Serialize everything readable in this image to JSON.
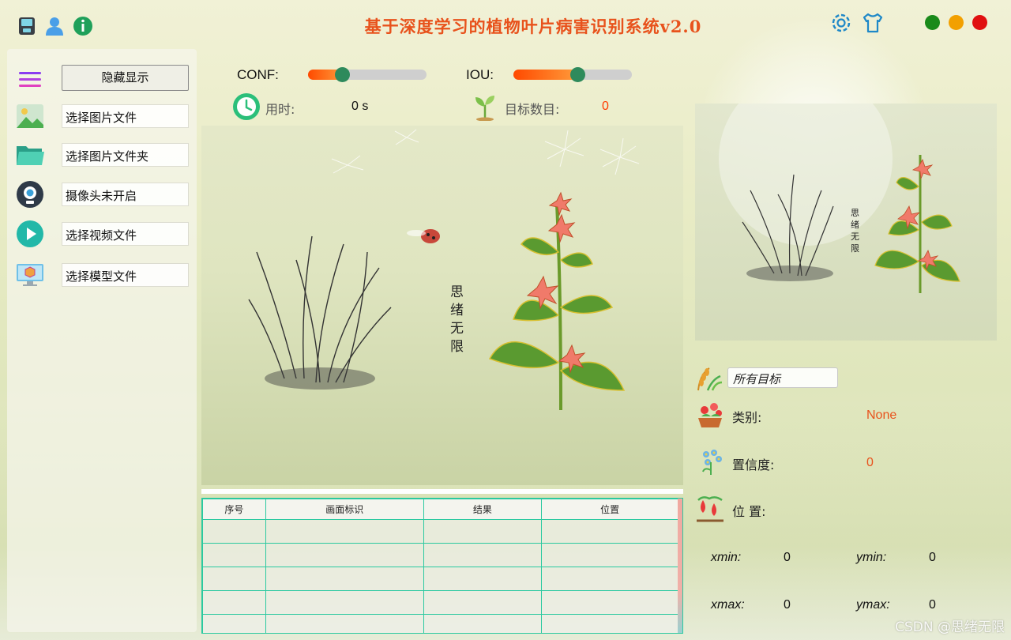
{
  "app": {
    "title": "基于深度学习的植物叶片病害识别系统v2.0"
  },
  "colors": {
    "title": "#e8521c",
    "accent_teal": "#2bc9a0",
    "window_close": "#e01010",
    "window_min": "#f2a000",
    "window_max": "#1a8a1a",
    "value_orange": "#e8521c"
  },
  "topbar": {
    "left_icons": [
      "save-icon",
      "user-icon",
      "info-icon"
    ],
    "right_icons": [
      "settings-gear-icon",
      "skin-shirt-icon"
    ]
  },
  "sidebar": {
    "toggle_label": "隐藏显示",
    "items": [
      {
        "label": "选择图片文件",
        "icon": "image-file-icon"
      },
      {
        "label": "选择图片文件夹",
        "icon": "folder-icon"
      },
      {
        "label": "摄像头未开启",
        "icon": "camera-icon"
      },
      {
        "label": "选择视频文件",
        "icon": "play-video-icon"
      },
      {
        "label": "选择模型文件",
        "icon": "model-monitor-icon"
      }
    ]
  },
  "controls": {
    "conf_label": "CONF:",
    "conf_value": 0.29,
    "iou_label": "IOU:",
    "iou_value": 0.54
  },
  "stats": {
    "time_label": "用时:",
    "time_value": "0 s",
    "count_label": "目标数目:",
    "count_value": "0"
  },
  "image": {
    "calligraphy": "思绪无限"
  },
  "table": {
    "headers": [
      "序号",
      "画面标识",
      "结果",
      "位置"
    ],
    "rows": [
      [
        "",
        "",
        "",
        ""
      ],
      [
        "",
        "",
        "",
        ""
      ],
      [
        "",
        "",
        "",
        ""
      ],
      [
        "",
        "",
        "",
        ""
      ],
      [
        "",
        "",
        "",
        ""
      ]
    ]
  },
  "details": {
    "filter_value": "所有目标",
    "class_label": "类别:",
    "class_value": "None",
    "confidence_label": "置信度:",
    "confidence_value": "0",
    "position_label": "位 置:",
    "xmin_label": "xmin:",
    "xmin_value": "0",
    "ymin_label": "ymin:",
    "ymin_value": "0",
    "xmax_label": "xmax:",
    "xmax_value": "0",
    "ymax_label": "ymax:",
    "ymax_value": "0"
  },
  "watermark": "CSDN @思绪无限"
}
